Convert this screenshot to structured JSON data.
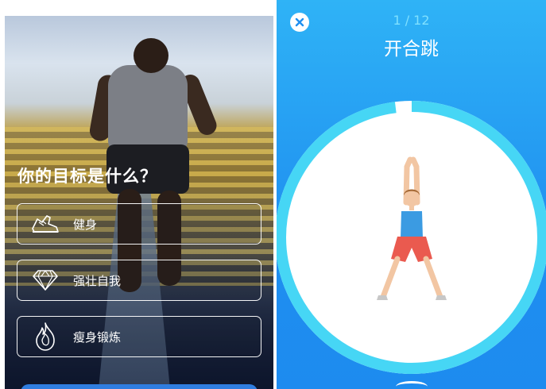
{
  "goal_screen": {
    "question": "你的目标是什么？",
    "options": [
      {
        "label": "健身",
        "icon": "running-shoe-icon"
      },
      {
        "label": "强壮自我",
        "icon": "diamond-icon"
      },
      {
        "label": "瘦身锻炼",
        "icon": "flame-icon"
      }
    ]
  },
  "exercise_screen": {
    "progress": "1 / 12",
    "title": "开合跳",
    "close_icon": "close-icon",
    "timer_progress_fraction": 0.98,
    "colors": {
      "background": "#1f8ff0",
      "ring_track": "#ffffff",
      "ring_progress": "#46d6f5",
      "progress_text": "#7fe0ff"
    }
  }
}
